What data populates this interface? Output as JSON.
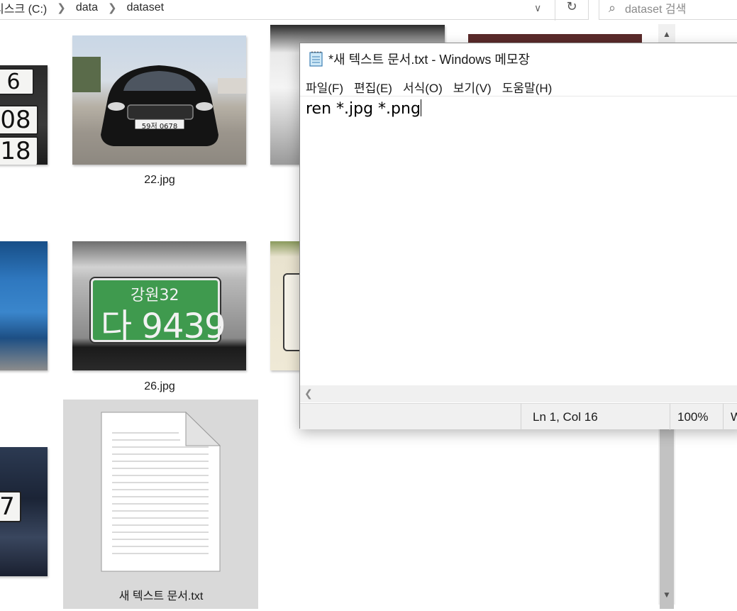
{
  "explorer": {
    "breadcrumb": [
      "디스크 (C:)",
      "data",
      "dataset"
    ],
    "search_placeholder": "dataset 검색",
    "files": [
      {
        "name": "22.jpg"
      },
      {
        "name": "26.jpg"
      },
      {
        "name": "새 텍스트 문서.txt"
      }
    ],
    "plates": {
      "car22": "59저 0678",
      "green_top": "강원32",
      "green_bottom": "다 9439",
      "left_top": "6",
      "left_mid": "08",
      "left_bot": "18",
      "left_row3": "7"
    }
  },
  "notepad": {
    "title": "*새 텍스트 문서.txt - Windows 메모장",
    "menu": [
      "파일(F)",
      "편집(E)",
      "서식(O)",
      "보기(V)",
      "도움말(H)"
    ],
    "content": "ren *.jpg *.png",
    "status": {
      "position": "Ln 1, Col 16",
      "zoom": "100%",
      "trailing": "W"
    }
  },
  "colors": {
    "window_border": "#8c8c8c",
    "selection": "#d9d9d9",
    "status_bg": "#f0f0f0",
    "plate_green": "#3f9a4e"
  },
  "icons": [
    "chevron-right-icon",
    "chevron-down-icon",
    "refresh-icon",
    "search-icon",
    "notepad-icon",
    "text-file-icon",
    "scroll-up-icon",
    "scroll-down-icon",
    "scroll-left-icon"
  ]
}
